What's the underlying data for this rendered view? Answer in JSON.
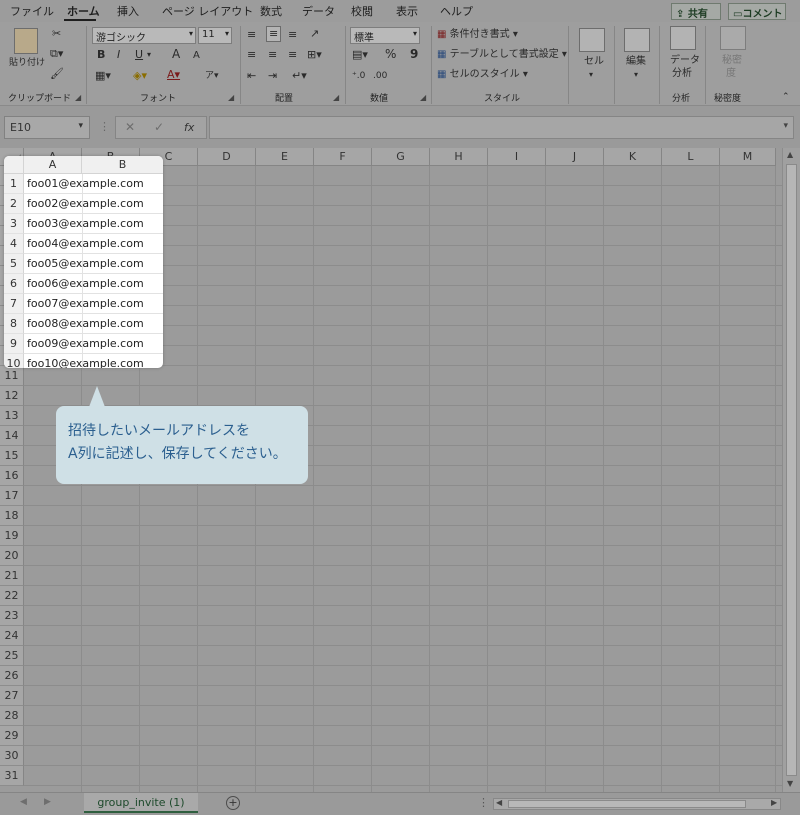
{
  "ribbon_tabs": [
    "ファイル",
    "ホーム",
    "挿入",
    "ページ レイアウト",
    "数式",
    "データ",
    "校閲",
    "表示",
    "ヘルプ"
  ],
  "active_tab": "ホーム",
  "top_buttons": {
    "share": "共有",
    "comment": "コメント"
  },
  "ribbon": {
    "clipboard": {
      "paste": "貼り付け",
      "label": "クリップボード"
    },
    "font": {
      "name": "游ゴシック",
      "size": "11",
      "bold": "B",
      "italic": "I",
      "underline": "U",
      "grow": "A",
      "shrink": "A",
      "color_a": "A",
      "label": "フォント"
    },
    "alignment": {
      "label": "配置"
    },
    "number": {
      "format": "標準",
      "percent": "%",
      "comma": "9",
      "label": "数値"
    },
    "styles": {
      "conditional": "条件付き書式",
      "table": "テーブルとして書式設定",
      "cell_styles": "セルのスタイル",
      "label": "スタイル"
    },
    "cells": {
      "label": "セル"
    },
    "editing": {
      "label": "編集"
    },
    "analysis": {
      "data_analysis_1": "データ",
      "data_analysis_2": "分析",
      "label": "分析"
    },
    "sensitivity": {
      "btn_1": "秘密",
      "btn_2": "度",
      "label": "秘密度"
    }
  },
  "formula_bar": {
    "name_box": "E10",
    "cancel": "✕",
    "enter": "✓",
    "fx": "fx",
    "value": ""
  },
  "columns": [
    "A",
    "B",
    "C",
    "D",
    "E",
    "F",
    "G",
    "H",
    "I",
    "J",
    "K",
    "L",
    "M"
  ],
  "rows": [
    "1",
    "2",
    "3",
    "4",
    "5",
    "6",
    "7",
    "8",
    "9",
    "10",
    "11",
    "12",
    "13",
    "14",
    "15",
    "16",
    "17",
    "18",
    "19",
    "20",
    "21",
    "22",
    "23",
    "24",
    "25",
    "26",
    "27",
    "28",
    "29",
    "30",
    "31"
  ],
  "cells_a": [
    "foo01@example.com",
    "foo02@example.com",
    "foo03@example.com",
    "foo04@example.com",
    "foo05@example.com",
    "foo06@example.com",
    "foo07@example.com",
    "foo08@example.com",
    "foo09@example.com",
    "foo10@example.com"
  ],
  "callout": {
    "line1": "招待したいメールアドレスを",
    "line2": "A列に記述し、保存してください。"
  },
  "sheet_tab": "group_invite (1)",
  "add_sheet": "+"
}
